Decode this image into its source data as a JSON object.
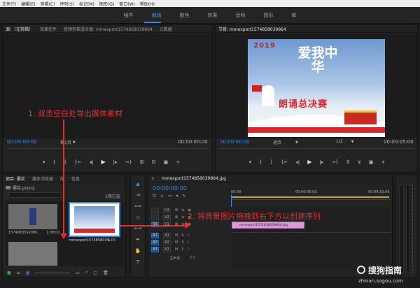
{
  "menu": [
    "文件(F)",
    "编辑(E)",
    "剪辑(C)",
    "序列(S)",
    "标记(M)",
    "图形(G)",
    "窗口(W)",
    "帮助(H)"
  ],
  "workspaces": [
    "组件",
    "编辑",
    "颜色",
    "效果",
    "音频",
    "图形",
    "库"
  ],
  "active_workspace": "编辑",
  "source_panel": {
    "tabs": [
      "源：（无剪辑）",
      "效果控件",
      "音频剪辑混合器: mmexport1574858039864",
      "元数据"
    ],
    "timecode": "00:00:00:00",
    "page": "第1页",
    "duration": "00:00:00:00"
  },
  "program_panel": {
    "tab": "节目: mmexport1574858039864",
    "timecode": "00:00:00:00",
    "fit": "适合",
    "ratio": "1/2",
    "duration": "00:00:05:00"
  },
  "poster": {
    "year": "2019",
    "slogan": "爱我中华",
    "sub": "朗诵总决赛"
  },
  "project_panel": {
    "tabs": [
      "项目: 屡实",
      "媒体浏览器",
      "库",
      "信息"
    ],
    "project_file": "屡实.prproj",
    "item_count": "1项已选",
    "items": [
      {
        "name": "1574863592986...",
        "duration": "1;08;00"
      },
      {
        "name": "mmexport1574858039...",
        "duration": "5:00"
      }
    ]
  },
  "timeline": {
    "timecode": "00:00:00:00",
    "ruler": [
      "00:00",
      "00:00:05:00",
      "00:00:10:00"
    ],
    "video_tracks": [
      "V3",
      "V2",
      "V1"
    ],
    "audio_tracks": [
      "A1",
      "A2",
      "A3"
    ],
    "master": "主声道",
    "master_value": "0.0",
    "clip_label": "mmexport1574858039864.jpg"
  },
  "annotations": {
    "step1": "1. 双击空白处导出媒体素材",
    "step2": "2. 将背景图片拖拽到右下方以创建序列"
  },
  "watermark": {
    "name": "搜狗指南",
    "url": "zhinan.sogou.com"
  },
  "colors": {
    "accent": "#2d8ceb",
    "clip": "#d99ad8",
    "annotation": "#e03030"
  }
}
